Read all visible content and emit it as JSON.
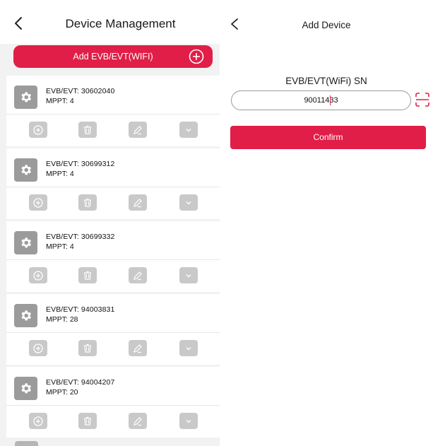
{
  "management": {
    "title": "Device Management",
    "add_button_label": "Add EVB/EVT(WIFI)",
    "devices": [
      {
        "line1": "EVB/EVT:  30602040",
        "line2": "MPPT:  4"
      },
      {
        "line1": "EVB/EVT:  30699312",
        "line2": "MPPT:  4"
      },
      {
        "line1": "EVB/EVT:  30699332",
        "line2": "MPPT:  4"
      },
      {
        "line1": "EVB/EVT:  94003831",
        "line2": "MPPT:  28"
      },
      {
        "line1": "EVB/EVT:  94004207",
        "line2": "MPPT:  20"
      }
    ]
  },
  "add_device": {
    "title": "Add Device",
    "sn_label": "EVB/EVT(WiFi) SN",
    "sn_value": "90011433",
    "confirm_label": "Confirm"
  },
  "colors": {
    "accent": "#e11e47",
    "action_gray": "#c9c9c9",
    "gear_gray": "#9b9b9b"
  },
  "icons": [
    "back-icon",
    "plus-circle-icon",
    "gear-icon",
    "trash-icon",
    "edit-icon",
    "chevron-down-icon",
    "scan-icon"
  ]
}
